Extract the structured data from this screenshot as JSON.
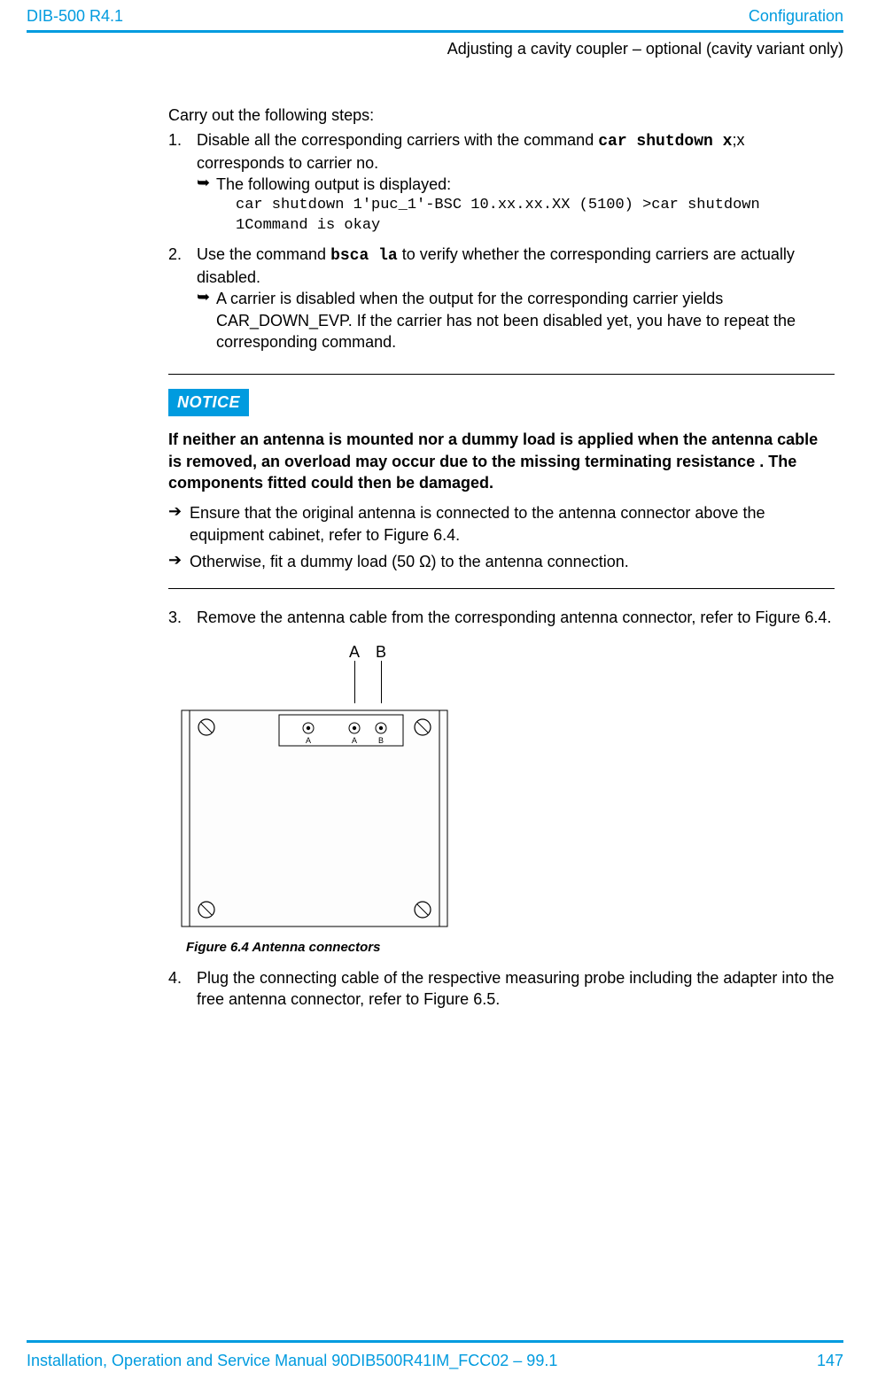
{
  "header": {
    "left": "DIB-500 R4.1",
    "right": "Configuration",
    "sub": "Adjusting a cavity coupler – optional (cavity variant only)"
  },
  "intro": "Carry out the following steps:",
  "steps": {
    "s1": {
      "marker": "1.",
      "text_a": "Disable all the corresponding carriers with the command ",
      "cmd": "car shutdown x",
      "text_b": ";x corresponds to carrier no."
    },
    "s1a": {
      "label": "The following output is displayed:",
      "code_l1": "car shutdown 1'puc_1'-BSC 10.xx.xx.XX (5100) >car shutdown",
      "code_l2": "1Command is okay"
    },
    "s2": {
      "marker": "2.",
      "text_a": "Use the command ",
      "cmd": "bsca la",
      "text_b": " to verify whether the corresponding carriers are actually disabled."
    },
    "s2a": {
      "text": "A carrier is disabled when the output for the corresponding carrier yields CAR_DOWN_EVP. If the carrier has not been disabled yet, you have to repeat the corresponding command."
    },
    "s3": {
      "marker": "3.",
      "text": "Remove the antenna cable from the corresponding antenna connector, refer to Figure 6.4."
    },
    "s4": {
      "marker": "4.",
      "text": "Plug the connecting cable of the respective measuring probe including the adapter into the free antenna connector, refer to Figure 6.5."
    }
  },
  "notice": {
    "badge": "NOTICE",
    "text": "If neither an antenna is mounted nor a dummy load is applied when the antenna cable is removed, an overload may occur due to the missing terminating resistance . The components fitted could then be damaged.",
    "b1": "Ensure that the original antenna is connected to the antenna connector above the equipment cabinet, refer to Figure 6.4.",
    "b2": "Otherwise, fit a dummy load (50 Ω) to the antenna connection."
  },
  "figure": {
    "label_a": "A",
    "label_b": "B",
    "panel_a": "A",
    "panel_ab_a": "A",
    "panel_ab_b": "B",
    "caption": "Figure 6.4 Antenna connectors"
  },
  "footer": {
    "left": "Installation, Operation and Service Manual 90DIB500R41IM_FCC02 – 99.1",
    "right": "147"
  }
}
